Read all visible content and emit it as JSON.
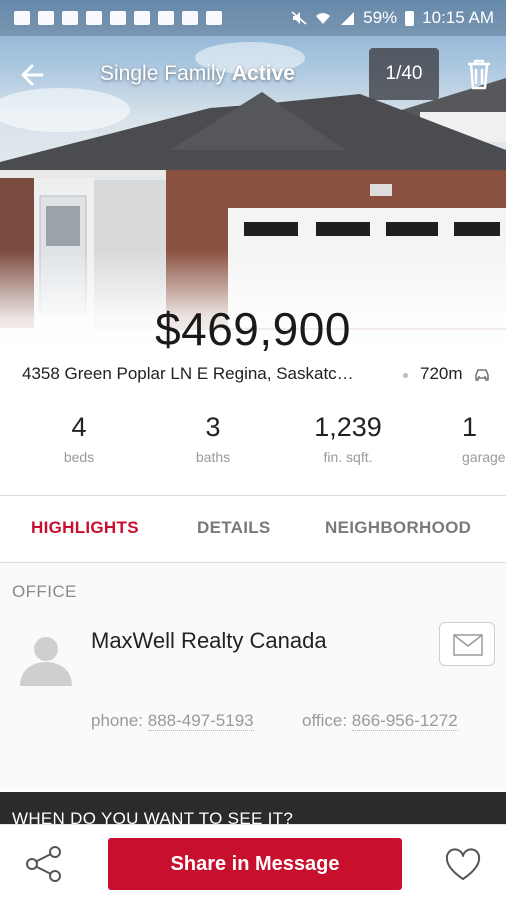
{
  "status_bar": {
    "battery": "59%",
    "time": "10:15 AM"
  },
  "top_bar": {
    "title_prefix": "Single Family",
    "title_status": "Active",
    "photo_counter": "1/40",
    "icons": {
      "back": "arrow-left-icon",
      "delete": "trash-icon"
    }
  },
  "listing": {
    "price": "$469,900",
    "address": "4358 Green Poplar LN E Regina, Saskatc…",
    "distance": "720m",
    "stats": [
      {
        "value": "4",
        "label": "beds"
      },
      {
        "value": "3",
        "label": "baths"
      },
      {
        "value": "1,239",
        "label": "fin. sqft."
      },
      {
        "value": "1",
        "label": "garage"
      }
    ]
  },
  "tabs": [
    {
      "label": "HIGHLIGHTS",
      "active": true
    },
    {
      "label": "DETAILS",
      "active": false
    },
    {
      "label": "NEIGHBORHOOD",
      "active": false
    }
  ],
  "office": {
    "section_title": "OFFICE",
    "name": "MaxWell Realty Canada",
    "phone_label": "phone:",
    "phone": "888-497-5193",
    "office_label": "office:",
    "office_phone": "866-956-1272"
  },
  "banner": {
    "text": "WHEN DO YOU WANT TO SEE IT?"
  },
  "bottom_bar": {
    "primary_button": "Share in Message",
    "icons": {
      "share": "share-icon",
      "favorite": "heart-icon"
    }
  },
  "colors": {
    "accent": "#c8102e",
    "banner": "#2b2b2b",
    "muted_text": "#9a9a9a"
  }
}
